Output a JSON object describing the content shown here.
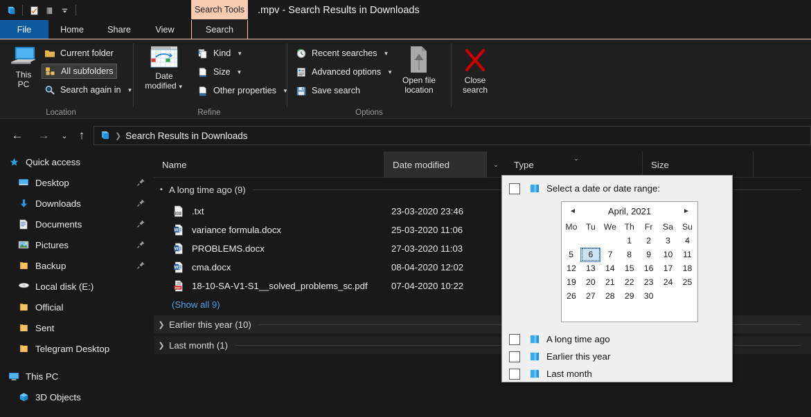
{
  "window": {
    "title": ".mpv - Search Results in Downloads",
    "contextual_tab_group": "Search Tools",
    "quick_access_icons": [
      "explorer-icon",
      "properties-icon",
      "new-folder-icon",
      "customize-dropdown-icon"
    ]
  },
  "tabs": [
    {
      "label": "File",
      "id": "file"
    },
    {
      "label": "Home",
      "id": "home"
    },
    {
      "label": "Share",
      "id": "share"
    },
    {
      "label": "View",
      "id": "view"
    },
    {
      "label": "Search",
      "id": "search"
    }
  ],
  "ribbon": {
    "groups": [
      {
        "caption": "Location"
      },
      {
        "caption": "Refine"
      },
      {
        "caption": "Options"
      }
    ],
    "location": {
      "this_pc": "This\nPC",
      "this_pc_line1": "This",
      "this_pc_line2": "PC",
      "current_folder": "Current folder",
      "all_subfolders": "All subfolders",
      "search_again_in": "Search again in"
    },
    "refine": {
      "date_modified_line1": "Date",
      "date_modified_line2": "modified",
      "kind": "Kind",
      "size": "Size",
      "other_properties": "Other properties"
    },
    "options": {
      "recent_searches": "Recent searches",
      "advanced_options": "Advanced options",
      "save_search": "Save search",
      "open_file_location_line1": "Open file",
      "open_file_location_line2": "location",
      "close_search_line1": "Close",
      "close_search_line2": "search"
    }
  },
  "address_bar": {
    "path_icon": "explorer-folder-icon",
    "path": "Search Results in Downloads"
  },
  "sidebar": {
    "items": [
      {
        "label": "Quick access",
        "icon": "star-icon",
        "indent": 10,
        "pinned": false
      },
      {
        "label": "Desktop",
        "icon": "desktop-icon",
        "indent": 24,
        "pinned": true
      },
      {
        "label": "Downloads",
        "icon": "download-icon",
        "indent": 24,
        "pinned": true
      },
      {
        "label": "Documents",
        "icon": "documents-icon",
        "indent": 24,
        "pinned": true
      },
      {
        "label": "Pictures",
        "icon": "pictures-icon",
        "indent": 24,
        "pinned": true
      },
      {
        "label": "Backup",
        "icon": "folder-icon",
        "indent": 24,
        "pinned": true
      },
      {
        "label": "Local disk (E:)",
        "icon": "disk-icon",
        "indent": 24,
        "pinned": false
      },
      {
        "label": "Official",
        "icon": "folder-icon",
        "indent": 24,
        "pinned": false
      },
      {
        "label": "Sent",
        "icon": "folder-icon",
        "indent": 24,
        "pinned": false
      },
      {
        "label": "Telegram Desktop",
        "icon": "folder-icon",
        "indent": 24,
        "pinned": false
      },
      {
        "label": "This PC",
        "icon": "this-pc-icon",
        "indent": 10,
        "pinned": false
      },
      {
        "label": "3D Objects",
        "icon": "3d-objects-icon",
        "indent": 24,
        "pinned": false
      }
    ]
  },
  "file_list": {
    "columns": [
      {
        "label": "Name",
        "active": false
      },
      {
        "label": "Date modified",
        "active": true
      },
      {
        "label": "Type",
        "active": false
      },
      {
        "label": "Size",
        "active": false
      }
    ],
    "groups": [
      {
        "label": "A long time ago (9)",
        "expanded": true,
        "files": [
          {
            "name": ".txt",
            "date": "23-03-2020 23:46",
            "icon": "txt-file-icon"
          },
          {
            "name": "variance formula.docx",
            "date": "25-03-2020 11:06",
            "icon": "word-file-icon"
          },
          {
            "name": "PROBLEMS.docx",
            "date": "27-03-2020 11:03",
            "icon": "word-file-icon"
          },
          {
            "name": "cma.docx",
            "date": "08-04-2020 12:02",
            "icon": "word-file-icon"
          },
          {
            "name": "18-10-SA-V1-S1__solved_problems_sc.pdf",
            "date": "07-04-2020 10:22",
            "icon": "pdf-file-icon"
          }
        ],
        "show_all": "(Show all 9)"
      },
      {
        "label": "Earlier this year (10)",
        "expanded": false,
        "files": [],
        "show_all": ""
      },
      {
        "label": "Last month (1)",
        "expanded": false,
        "files": [],
        "show_all": ""
      }
    ]
  },
  "date_panel": {
    "select_range_label": "Select a date or date range:",
    "calendar": {
      "month_title": "April, 2021",
      "prev_label": "◄",
      "next_label": "►",
      "weekdays": [
        "Mo",
        "Tu",
        "We",
        "Th",
        "Fr",
        "Sa",
        "Su"
      ],
      "weeks": [
        [
          "",
          "",
          "",
          "1",
          "2",
          "3",
          "4"
        ],
        [
          "5",
          "6",
          "7",
          "8",
          "9",
          "10",
          "11"
        ],
        [
          "12",
          "13",
          "14",
          "15",
          "16",
          "17",
          "18"
        ],
        [
          "19",
          "20",
          "21",
          "22",
          "23",
          "24",
          "25"
        ],
        [
          "26",
          "27",
          "28",
          "29",
          "30",
          "",
          ""
        ]
      ],
      "selected_day": "6"
    },
    "options": [
      {
        "label": "A long time ago",
        "checked": false
      },
      {
        "label": "Earlier this year",
        "checked": false
      },
      {
        "label": "Last month",
        "checked": false
      }
    ]
  },
  "colors": {
    "window_bg": "#191919",
    "ribbon_bg": "#1f1f1f",
    "contextual_accent": "#f7cbb1",
    "file_tab_blue": "#0d5a9e",
    "link_blue": "#4ea3e0",
    "panel_bg": "#f0f0f0",
    "selected_day_bg": "#cce4f7"
  }
}
